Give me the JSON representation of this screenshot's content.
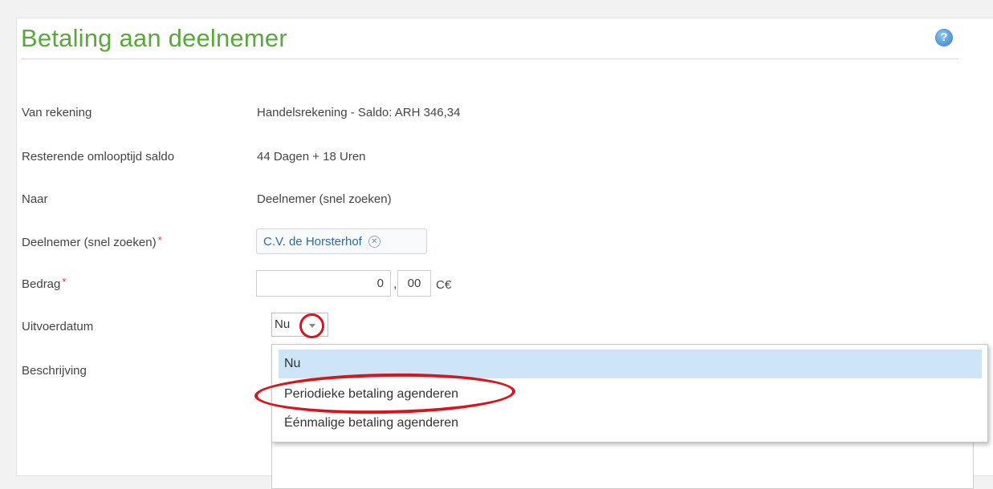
{
  "page": {
    "title": "Betaling aan deelnemer",
    "help_icon": "question-circle-icon"
  },
  "form": {
    "from_account_label": "Van rekening",
    "from_account_value": "Handelsrekening - Saldo: ARH 346,34",
    "remaining_label": "Resterende omlooptijd saldo",
    "remaining_value": "44 Dagen + 18 Uren",
    "to_label": "Naar",
    "to_value": "Deelnemer (snel zoeken)",
    "member_label": "Deelnemer (snel zoeken)",
    "member_value": "C.V. de Horsterhof",
    "required_mark": "*",
    "amount_label": "Bedrag",
    "amount_int": "0",
    "amount_sep": ",",
    "amount_dec": "00",
    "currency": "C€",
    "date_label": "Uitvoerdatum",
    "date_value": "Nu",
    "description_label": "Beschrijving"
  },
  "dropdown": {
    "options": [
      {
        "label": "Nu",
        "selected": true
      },
      {
        "label": "Periodieke betaling agenderen",
        "selected": false
      },
      {
        "label": "Éénmalige betaling agenderen",
        "selected": false
      }
    ]
  },
  "annotation_color": "#d9151b",
  "accent_color": "#5aa83c"
}
